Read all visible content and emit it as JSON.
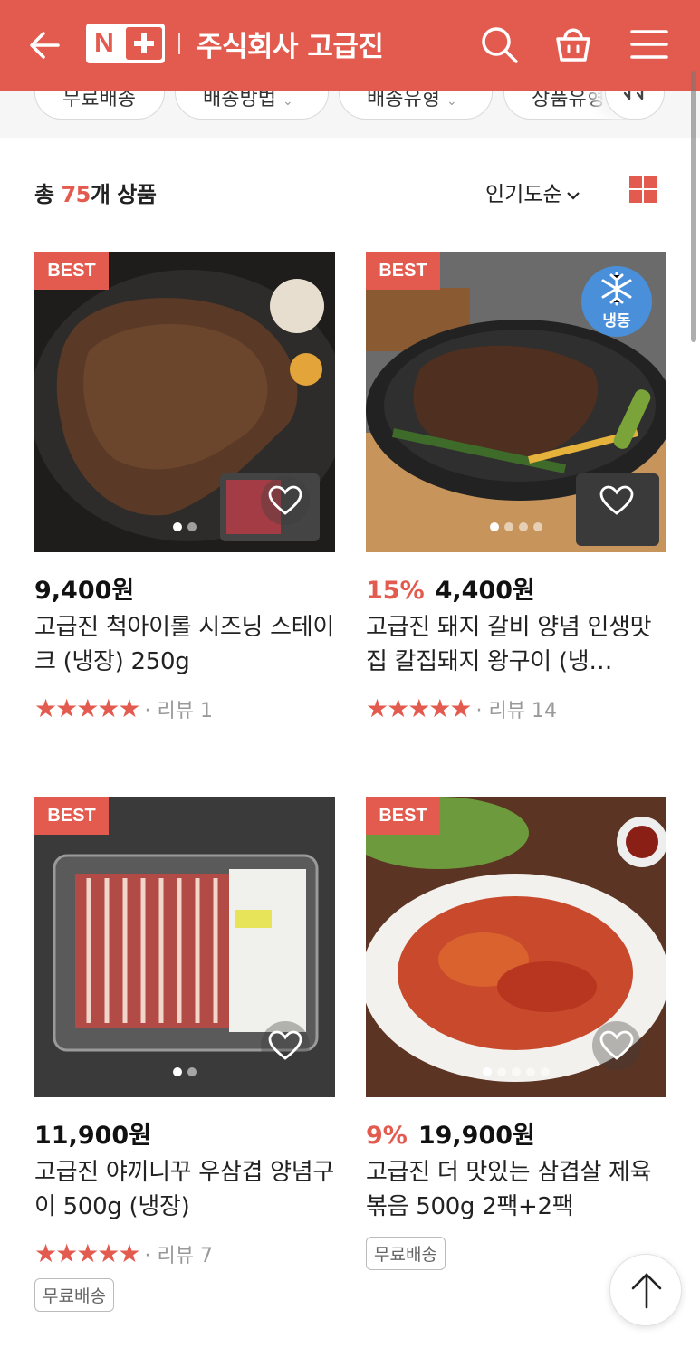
{
  "header": {
    "title": "주식회사 고급진",
    "logo_letter": "N",
    "colors": {
      "brand": "#e35a4e"
    },
    "icons": [
      "back-arrow-icon",
      "search-icon",
      "shopping-bag-icon",
      "menu-icon"
    ]
  },
  "filters": [
    {
      "label": "무료배송"
    },
    {
      "label": "배송방법"
    },
    {
      "label": "배송유형"
    },
    {
      "label": "상품유형"
    }
  ],
  "list": {
    "count_prefix": "총 ",
    "count_number": "75",
    "count_suffix": "개 상품",
    "sort_label": "인기도순"
  },
  "products": [
    {
      "badge": "BEST",
      "discount": "",
      "price": "9,400원",
      "name": "고급진 척아이롤 시즈닝 스테이크 (냉장) 250g",
      "stars": "★★★★★",
      "review": "· 리뷰 1",
      "free_shipping": ""
    },
    {
      "badge": "BEST",
      "frozen_label": "냉동",
      "discount": "15%",
      "price": "4,400원",
      "name": "고급진 돼지 갈비 양념 인생맛집 칼집돼지 왕구이 (냉…",
      "stars": "★★★★★",
      "review": "· 리뷰 14",
      "free_shipping": ""
    },
    {
      "badge": "BEST",
      "discount": "",
      "price": "11,900원",
      "name": "고급진 야끼니꾸 우삼겹 양념구이 500g (냉장)",
      "stars": "★★★★★",
      "review": "· 리뷰 7",
      "free_shipping": "무료배송"
    },
    {
      "badge": "BEST",
      "discount": "9%",
      "price": "19,900원",
      "name": "고급진 더 맛있는 삼겹살 제육볶음 500g 2팩+2팩",
      "stars": "",
      "review": "",
      "free_shipping": "무료배송"
    }
  ]
}
